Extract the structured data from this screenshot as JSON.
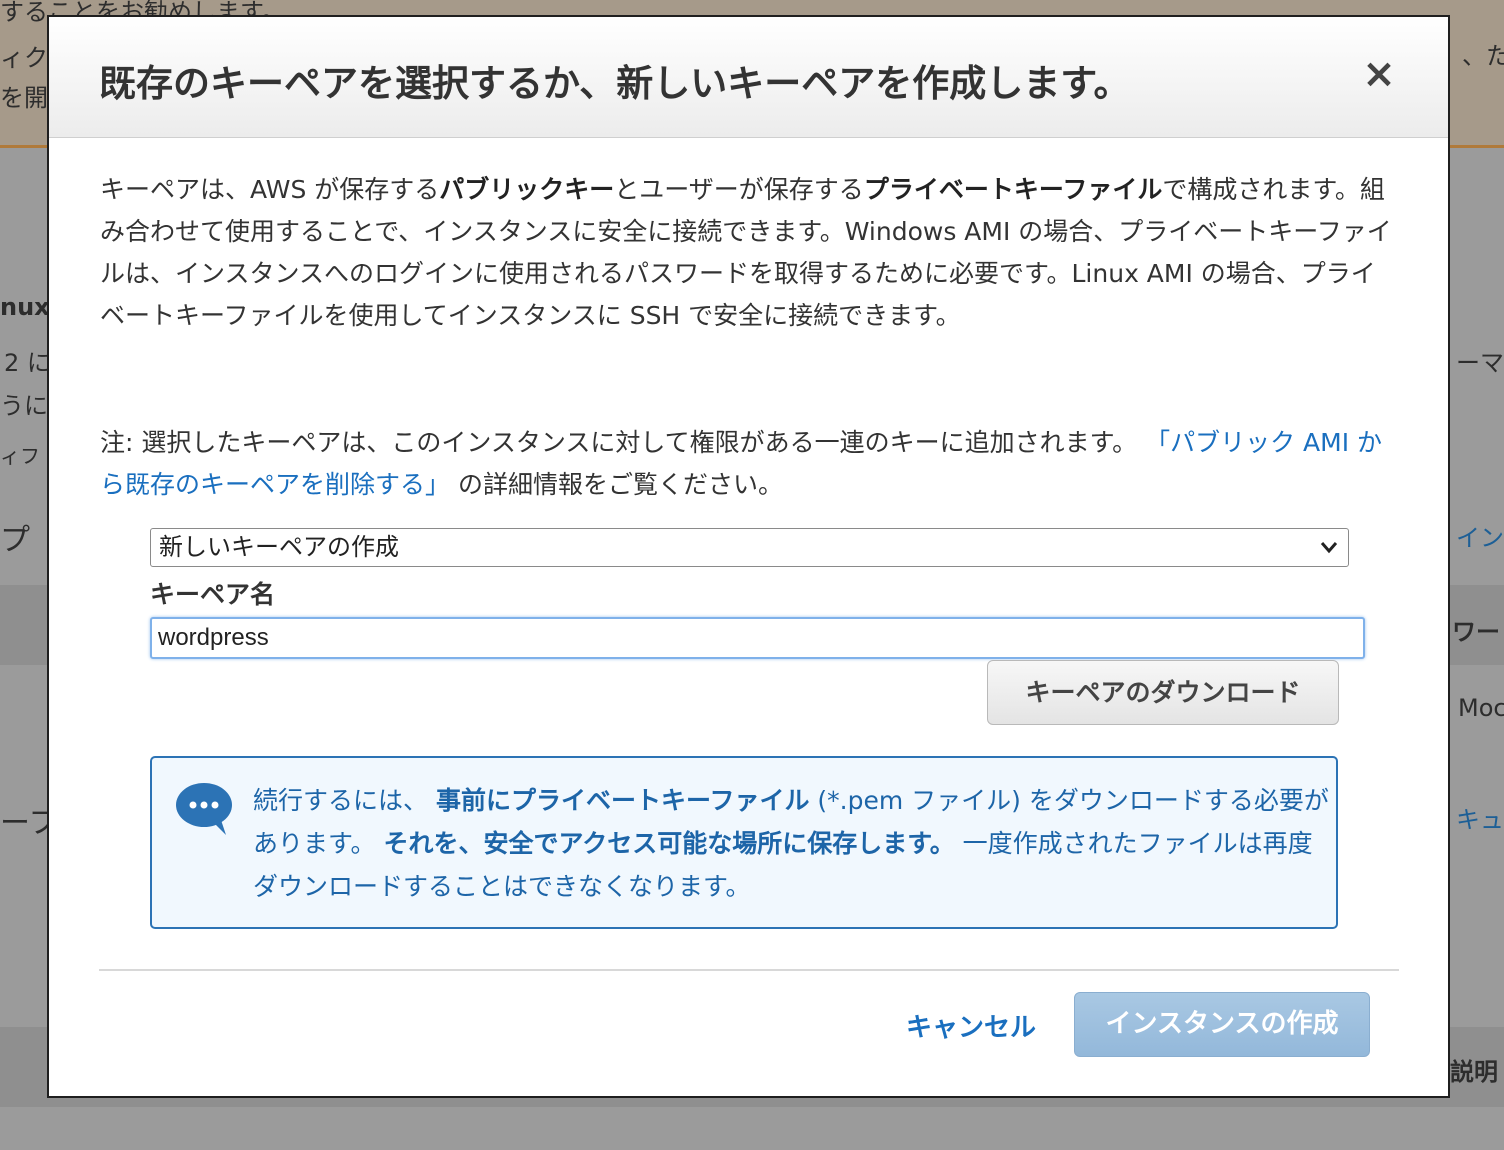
{
  "background": {
    "fragments": [
      "することをお勧めします。",
      "ィク",
      "を開",
      "、た",
      "nux",
      "2 に",
      "うに",
      "ィフ",
      "プ",
      "ーマ",
      "インス",
      "ワー",
      "Moc",
      "ーフ",
      "キュ",
      "説明"
    ]
  },
  "modal": {
    "title": "既存のキーペアを選択するか、新しいキーペアを作成します。",
    "close_symbol": "×",
    "description": {
      "part1": "キーペアは、AWS が保存する",
      "bold1": "パブリックキー",
      "part2": "とユーザーが保存する",
      "bold2": "プライベートキーファイル",
      "part3": "で構成されます。組み合わせて使用することで、インスタンスに安全に接続できます。Windows AMI の場合、プライベートキーファイルは、インスタンスへのログインに使用されるパスワードを取得するために必要です。Linux AMI の場合、プライベートキーファイルを使用してインスタンスに SSH で安全に接続できます。"
    },
    "note": {
      "prefix": "注: 選択したキーペアは、このインスタンスに対して権限がある一連のキーに追加されます。 ",
      "link": "「パブリック AMI から既存のキーペアを削除する」",
      "suffix": " の詳細情報をご覧ください。"
    },
    "key_pair_select": {
      "selected": "新しいキーペアの作成"
    },
    "key_pair_name": {
      "label": "キーペア名",
      "value": "wordpress"
    },
    "download_button": "キーペアのダウンロード",
    "info": {
      "part1": "続行するには、 ",
      "bold1": "事前にプライベートキーファイル",
      "part2": " (*.pem ファイル) をダウンロードする必要があります。 ",
      "bold2": "それを、安全でアクセス可能な場所に保存します。",
      "part3": " 一度作成されたファイルは再度ダウンロードすることはできなくなります。"
    },
    "cancel_label": "キャンセル",
    "create_label": "インスタンスの作成"
  },
  "colors": {
    "link": "#1a6fbf",
    "info_border": "#2c73b5",
    "info_bg": "#f1f8fe",
    "primary_disabled": "#9fc1e0"
  },
  "icons": {
    "info": "chat-bubble-icon",
    "close": "close-icon",
    "select": "chevron-down-icon"
  }
}
